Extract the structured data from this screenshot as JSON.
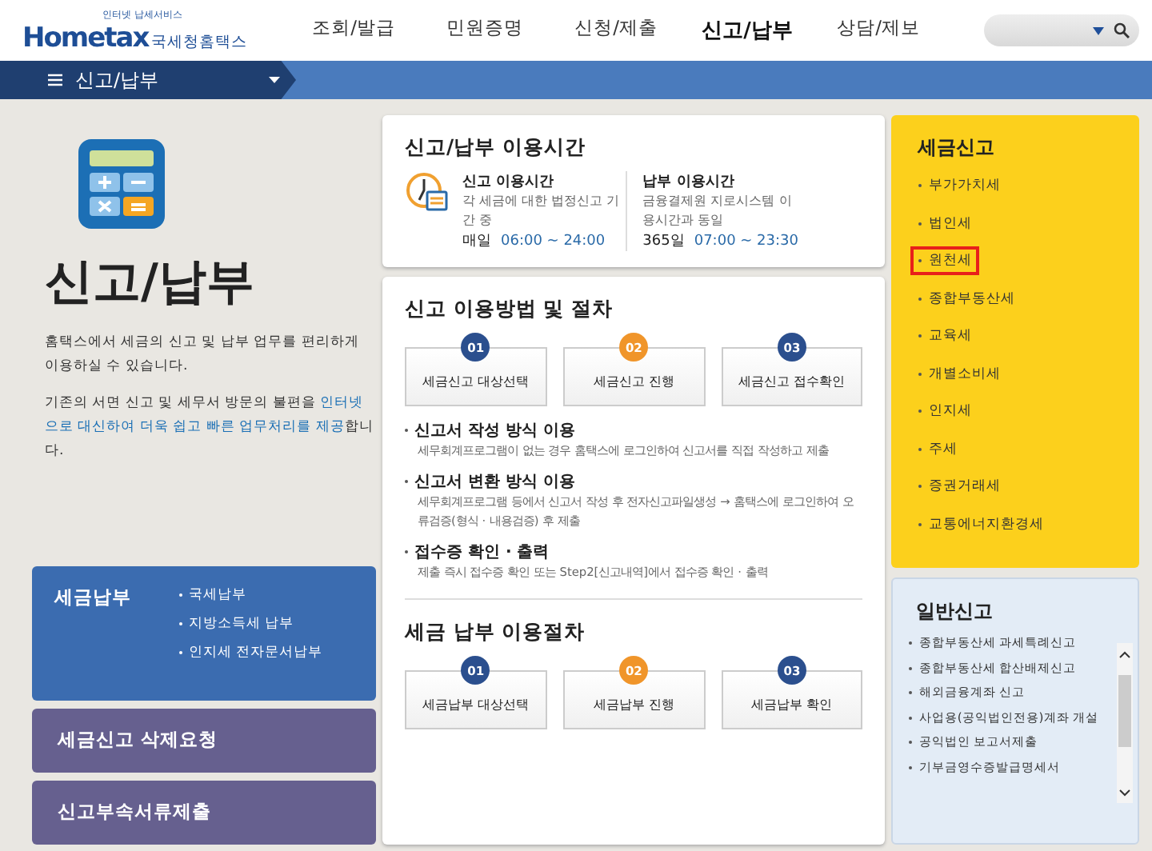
{
  "header": {
    "logo": {
      "tagline": "인터넷 납세서비스",
      "brand_en": "Hometax",
      "brand_ko": "국세청홈택스"
    },
    "nav": [
      {
        "label": "조회/발급",
        "selected": false
      },
      {
        "label": "민원증명",
        "selected": false
      },
      {
        "label": "신청/제출",
        "selected": false
      },
      {
        "label": "신고/납부",
        "selected": true
      },
      {
        "label": "상담/제보",
        "selected": false
      }
    ]
  },
  "subnav": {
    "menu": "신고/납부"
  },
  "intro": {
    "title": "신고/납부",
    "paragraphs": [
      "홈택스에서 세금의 신고 및 납부 업무를 편리하게 이용하실 수 있습니다.",
      "기존의 서면 신고 및 세무서 방문의 불편을 **인터넷으로 대신하여 더욱 쉽고 빠른 업무처리를 제공**합니다."
    ]
  },
  "quick_panels": [
    {
      "title": "세금납부",
      "color": "#3b6cb0",
      "links": [
        "국세납부",
        "지방소득세 납부",
        "인지세 전자문서납부"
      ]
    },
    {
      "title": "세금신고 삭제요청",
      "color": "#66608f"
    },
    {
      "title": "신고부속서류제출",
      "color": "#66608f"
    }
  ],
  "hours": {
    "title": "신고/납부 이용시간",
    "blocks": [
      {
        "title": "신고 이용시간",
        "desc": "각 세금에 대한 법정신고 기간 중",
        "day": "매일",
        "time": "06:00 ~ 24:00"
      },
      {
        "title": "납부 이용시간",
        "desc": "금융결제원 지로시스템 이용시간과 동일",
        "day": "365일",
        "time": "07:00 ~ 23:30"
      }
    ]
  },
  "filing": {
    "title": "신고 이용방법 및 절차",
    "steps": [
      {
        "number": "01",
        "label": "세금신고 대상선택",
        "color": "#2b4f8e"
      },
      {
        "number": "02",
        "label": "세금신고 진행",
        "color": "#f0952a"
      },
      {
        "number": "03",
        "label": "세금신고 접수확인",
        "color": "#2b4f8e"
      }
    ],
    "methods": [
      {
        "title": "신고서 작성 방식 이용",
        "desc": "세무회계프로그램이 없는 경우 홈택스에 로그인하여 신고서를 직접 작성하고 제출"
      },
      {
        "title": "신고서 변환 방식 이용",
        "desc": "세무회계프로그램 등에서 신고서 작성 후 전자신고파일생성 → 홈택스에 로그인하여 오류검증(형식 · 내용검증) 후 제출"
      },
      {
        "title": "접수증 확인 · 출력",
        "desc": "제출 즉시 접수증 확인 또는 Step2[신고내역]에서 접수증 확인 · 출력"
      }
    ]
  },
  "payment": {
    "title": "세금 납부 이용절차",
    "steps": [
      {
        "number": "01",
        "label": "세금납부 대상선택",
        "color": "#2b4f8e"
      },
      {
        "number": "02",
        "label": "세금납부 진행",
        "color": "#f0952a"
      },
      {
        "number": "03",
        "label": "세금납부 확인",
        "color": "#2b4f8e"
      }
    ]
  },
  "tax_filing": {
    "title": "세금신고",
    "items": [
      {
        "label": "부가가치세",
        "highlighted": false
      },
      {
        "label": "법인세",
        "highlighted": false
      },
      {
        "label": "원천세",
        "highlighted": true
      },
      {
        "label": "종합부동산세",
        "highlighted": false
      },
      {
        "label": "교육세",
        "highlighted": false
      },
      {
        "label": "개별소비세",
        "highlighted": false
      },
      {
        "label": "인지세",
        "highlighted": false
      },
      {
        "label": "주세",
        "highlighted": false
      },
      {
        "label": "증권거래세",
        "highlighted": false
      },
      {
        "label": "교통에너지환경세",
        "highlighted": false
      }
    ]
  },
  "general_filing": {
    "title": "일반신고",
    "items": [
      "종합부동산세 과세특례신고",
      "종합부동산세 합산배제신고",
      "해외금융계좌 신고",
      "사업용(공익법인전용)계좌 개설",
      "공익법인 보고서제출",
      "기부금영수증발급명세서"
    ]
  }
}
